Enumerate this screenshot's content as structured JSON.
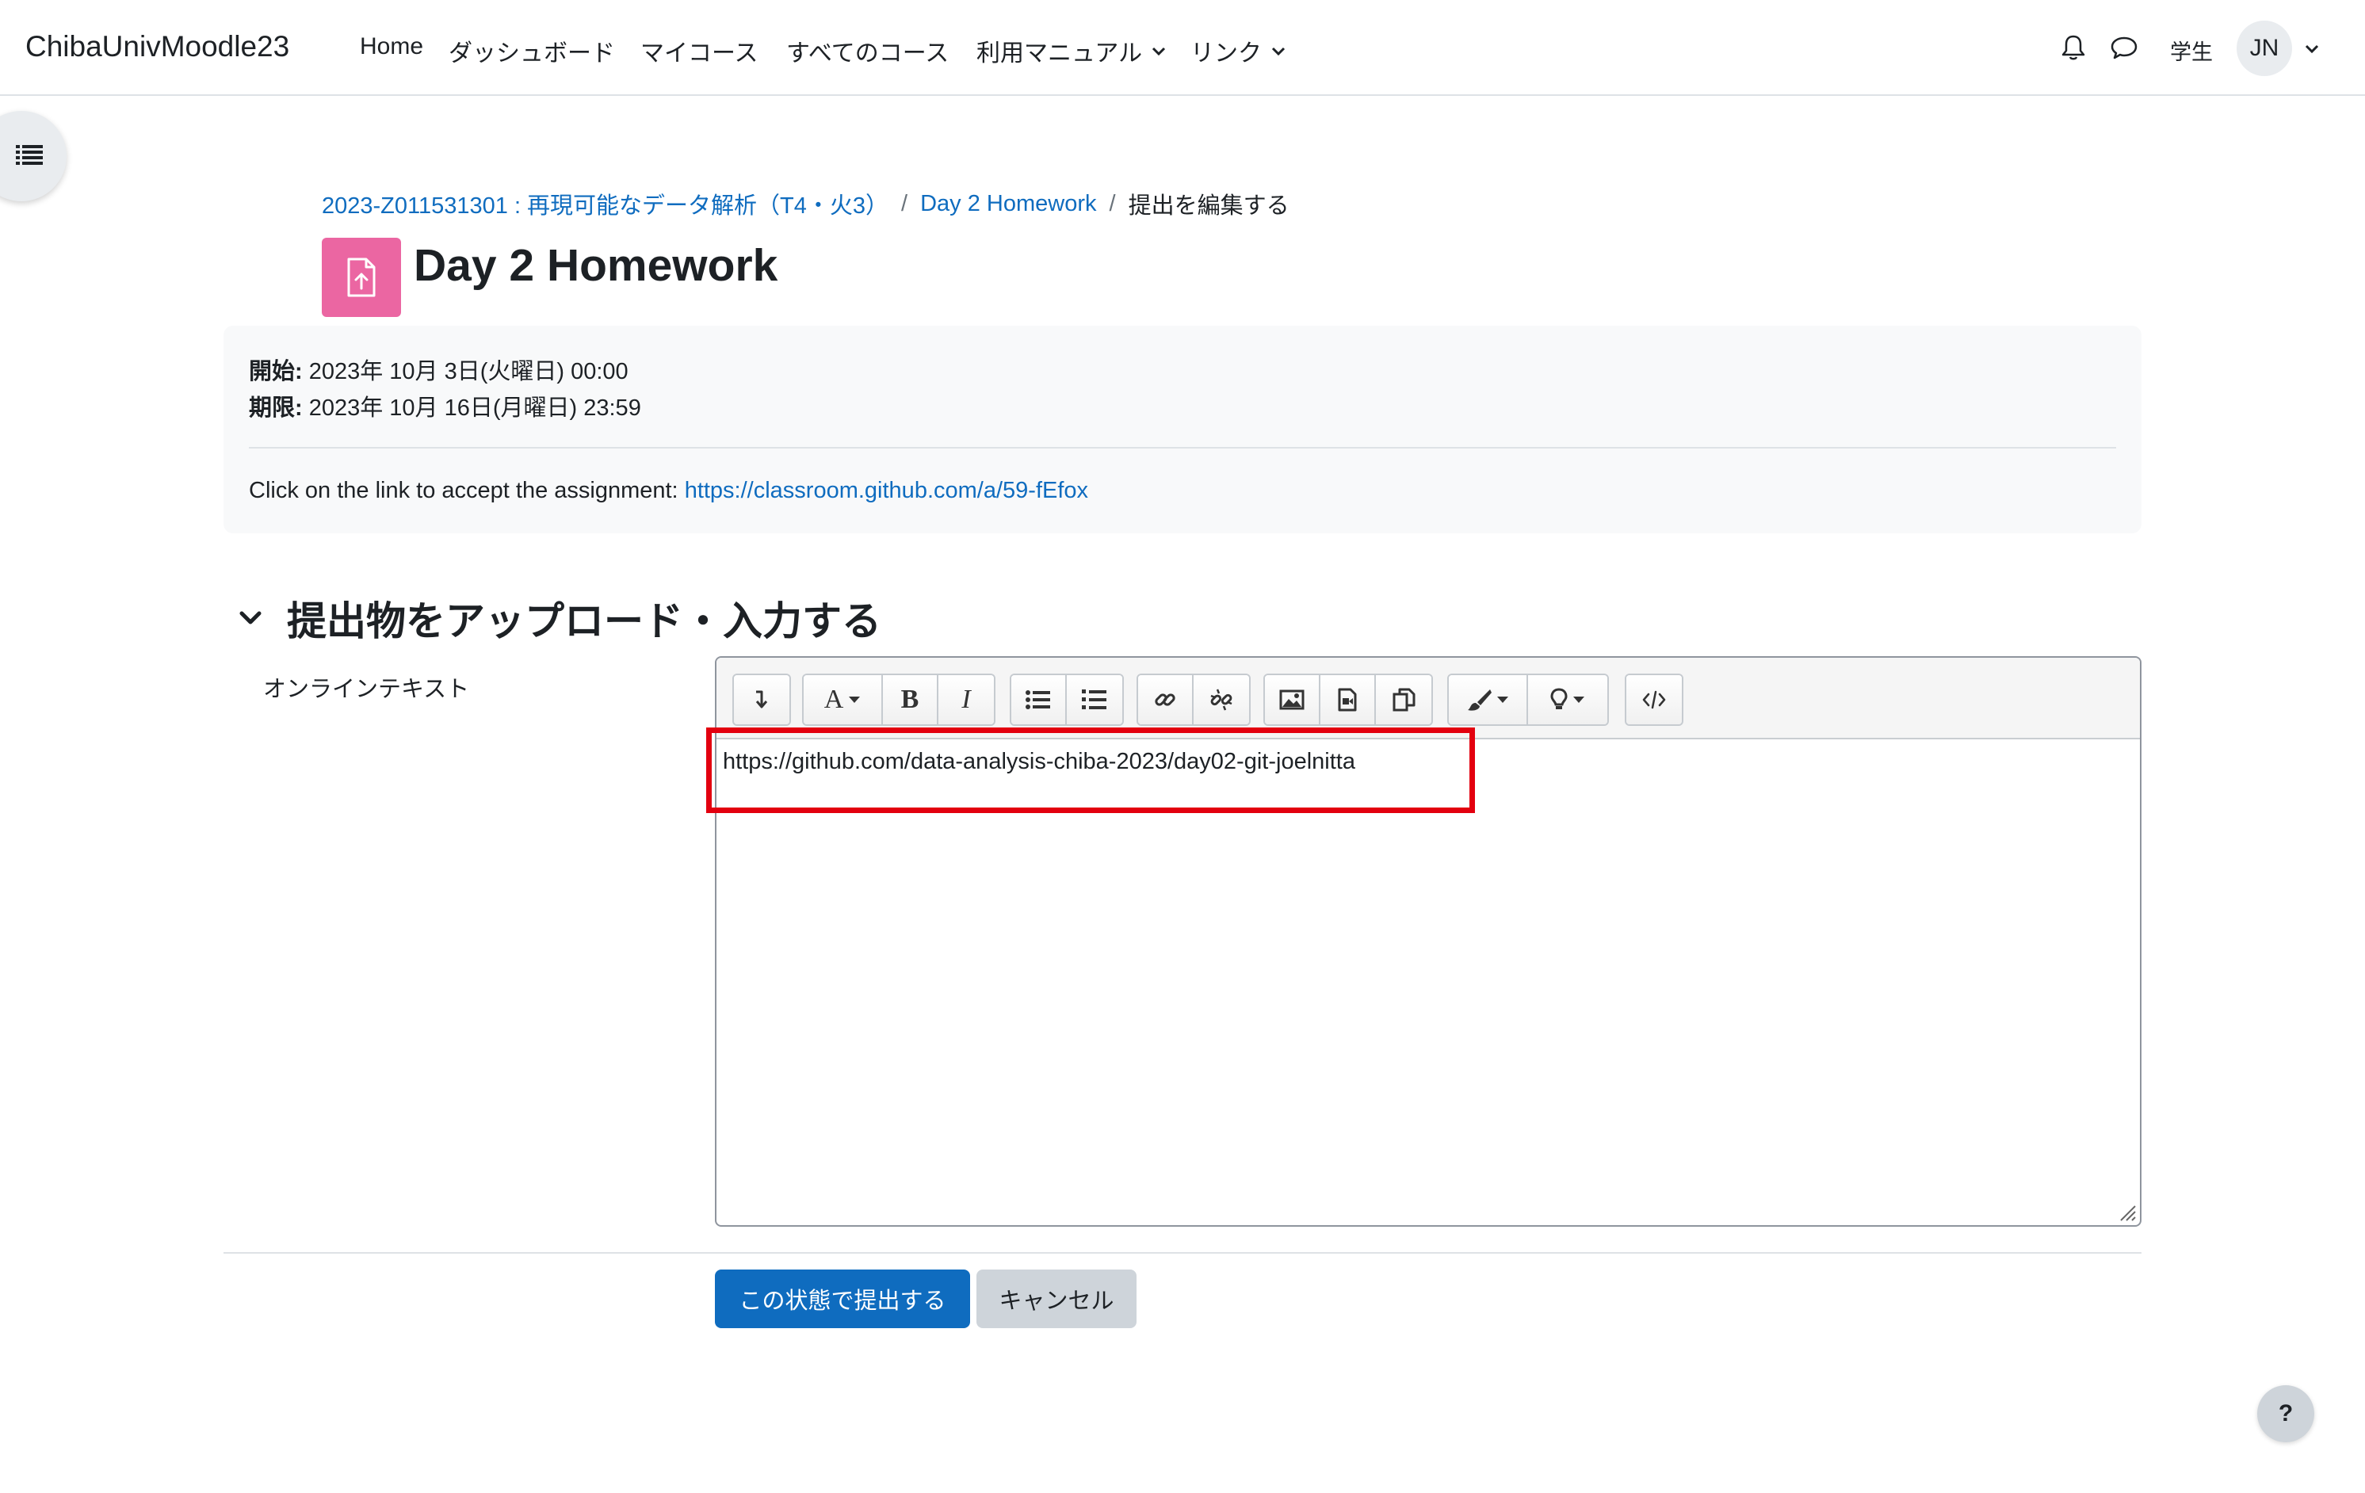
{
  "navbar": {
    "brand": "ChibaUnivMoodle23",
    "items": [
      {
        "label": "Home"
      },
      {
        "label": "ダッシュボード"
      },
      {
        "label": "マイコース"
      },
      {
        "label": "すべてのコース"
      },
      {
        "label": "利用マニュアル",
        "dropdown": true
      },
      {
        "label": "リンク",
        "dropdown": true
      }
    ],
    "role": "学生",
    "avatar_initials": "JN",
    "icons": [
      "bell-icon",
      "chat-bubble-icon"
    ]
  },
  "breadcrumb": {
    "course": "2023-Z011531301 : 再現可能なデータ解析（T4・火3）",
    "activity": "Day 2 Homework",
    "current": "提出を編集する",
    "separator": "/"
  },
  "header": {
    "title": "Day 2 Homework",
    "icon": "assignment-upload-icon",
    "icon_color": "#eb66a2"
  },
  "dates": {
    "opened_label": "開始:",
    "opened_value": "2023年 10月 3日(火曜日) 00:00",
    "due_label": "期限:",
    "due_value": "2023年 10月 16日(月曜日) 23:59"
  },
  "intro": {
    "text": "Click on the link to accept the assignment:",
    "link": "https://classroom.github.com/a/59-fEfox"
  },
  "section": {
    "title": "提出物をアップロード・入力する",
    "field_label": "オンラインテキスト"
  },
  "editor": {
    "content": "https://github.com/data-analysis-chiba-2023/day02-git-joelnitta",
    "toolbar": [
      "collapse-icon",
      "text-style-icon",
      "bold-icon",
      "italic-icon",
      "unordered-list-icon",
      "ordered-list-icon",
      "link-icon",
      "unlink-icon",
      "image-icon",
      "media-icon",
      "manage-files-icon",
      "text-color-icon",
      "equation-icon",
      "html-source-icon"
    ],
    "highlight_color": "#e3000f"
  },
  "actions": {
    "submit": "この状態で提出する",
    "cancel": "キャンセル"
  },
  "help_button": "?",
  "colors": {
    "link": "#0f6cbf",
    "primary": "#0f6cbf",
    "secondary": "#ced4da"
  }
}
